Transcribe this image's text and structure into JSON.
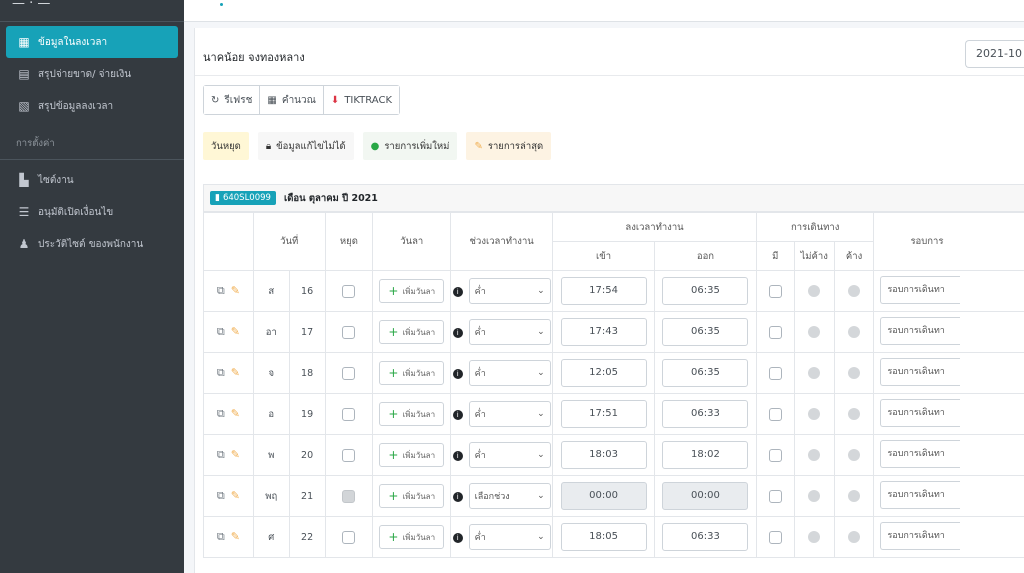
{
  "sidebar": {
    "brand": "— · —",
    "items": [
      {
        "label": "ข้อมูลในลงเวลา",
        "icon": "calendar-icon",
        "active": true
      },
      {
        "label": "สรุปจ่ายขาด/ จ่ายเงิน",
        "icon": "file-export-icon",
        "active": false
      },
      {
        "label": "สรุปข้อมูลลงเวลา",
        "icon": "file-chart-icon",
        "active": false
      }
    ],
    "settings_header": "การตั้งค่า",
    "settings_items": [
      {
        "label": "ไซต์งาน",
        "icon": "building-icon"
      },
      {
        "label": "อนุมัติเปิดเงื่อนไข",
        "icon": "list-check-icon"
      },
      {
        "label": "ประวัติไซต์ ของพนักงาน",
        "icon": "users-history-icon"
      }
    ]
  },
  "header": {
    "employee_name": "นาคน้อย จงทองหลาง",
    "date_value": "2021-10"
  },
  "toolbar": {
    "refresh_label": "รีเฟรช",
    "calc_label": "คำนวณ",
    "tiktrack_label": "TIKTRACK"
  },
  "legend": {
    "holiday": "วันหยุด",
    "locked": "ข้อมูลแก้ไขไม่ได้",
    "new": "รายการเพิ่มใหม่",
    "latest": "รายการล่าสุด"
  },
  "month_bar": {
    "employee_code": "640SL0099",
    "month_text": "เดือน ตุลาคม ปี 2021"
  },
  "table": {
    "headers": {
      "date": "วันที่",
      "holiday": "หยุด",
      "leave": "วันลา",
      "period": "ช่วงเวลาทำงาน",
      "work_time": "ลงเวลาทำงาน",
      "in": "เข้า",
      "out": "ออก",
      "travel": "การเดินทาง",
      "has": "มี",
      "no_overnight": "ไม่ค้าง",
      "overnight": "ค้าง",
      "round": "รอบการ"
    },
    "add_leave_label": "เพิ่มวันลา",
    "rows": [
      {
        "dow": "ส",
        "day": "16",
        "holiday": false,
        "period": "ค่ำ",
        "in": "17:54",
        "out": "06:35",
        "disabled": false,
        "trip": "รอบการเดินทา"
      },
      {
        "dow": "อา",
        "day": "17",
        "holiday": false,
        "period": "ค่ำ",
        "in": "17:43",
        "out": "06:35",
        "disabled": false,
        "trip": "รอบการเดินทา"
      },
      {
        "dow": "จ",
        "day": "18",
        "holiday": false,
        "period": "ค่ำ",
        "in": "12:05",
        "out": "06:35",
        "disabled": false,
        "trip": "รอบการเดินทา"
      },
      {
        "dow": "อ",
        "day": "19",
        "holiday": false,
        "period": "ค่ำ",
        "in": "17:51",
        "out": "06:33",
        "disabled": false,
        "trip": "รอบการเดินทา"
      },
      {
        "dow": "พ",
        "day": "20",
        "holiday": false,
        "period": "ค่ำ",
        "in": "18:03",
        "out": "18:02",
        "disabled": false,
        "trip": "รอบการเดินทา"
      },
      {
        "dow": "พฤ",
        "day": "21",
        "holiday": true,
        "period": "เลือกช่วง",
        "in": "00:00",
        "out": "00:00",
        "disabled": true,
        "trip": "รอบการเดินทา"
      },
      {
        "dow": "ศ",
        "day": "22",
        "holiday": false,
        "period": "ค่ำ",
        "in": "18:05",
        "out": "06:33",
        "disabled": false,
        "trip": "รอบการเดินทา"
      }
    ]
  }
}
